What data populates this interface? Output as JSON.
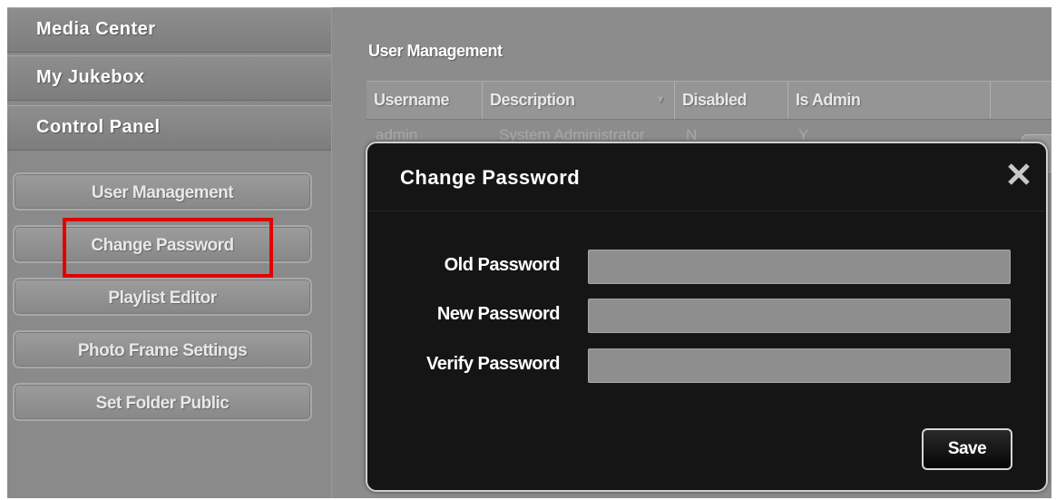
{
  "sidebar": {
    "headers": [
      "Media Center",
      "My Jukebox",
      "Control Panel"
    ],
    "buttons": [
      "User Management",
      "Change Password",
      "Playlist Editor",
      "Photo Frame Settings",
      "Set Folder Public"
    ]
  },
  "main": {
    "title": "User Management",
    "columns": [
      "Username",
      "Description",
      "Disabled",
      "Is Admin"
    ],
    "rows": [
      {
        "username": "admin",
        "description": "System Administrator",
        "disabled": "N",
        "is_admin": "Y"
      }
    ]
  },
  "modal": {
    "title": "Change Password",
    "labels": {
      "old_password": "Old Password",
      "new_password": "New Password",
      "verify_password": "Verify Password"
    },
    "values": {
      "old_password": "",
      "new_password": "",
      "verify_password": ""
    },
    "save_label": "Save",
    "close_icon": "close-icon"
  },
  "colors": {
    "highlight": "#e00000",
    "modal_bg": "#151515",
    "input_bg": "#8e8e8e"
  }
}
